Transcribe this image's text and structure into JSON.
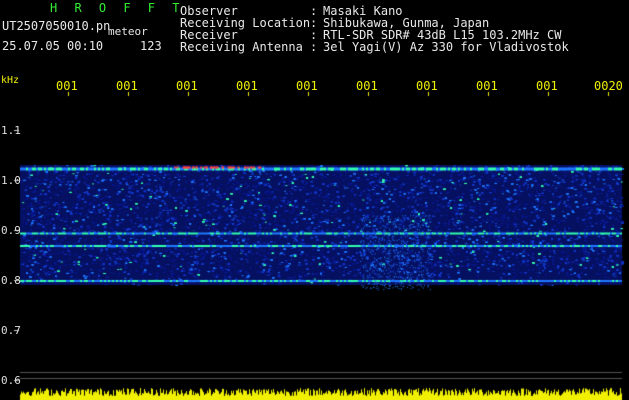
{
  "header": {
    "brand": "H R O F F T",
    "file_name": "UT2507050010.pn",
    "detection_type": "meteor",
    "datetime": "25.07.05 00:10",
    "count": "123"
  },
  "station_info": [
    {
      "label": "Observer",
      "sep": ":",
      "value": "Masaki Kano"
    },
    {
      "label": "Receiving Location",
      "sep": ":",
      "value": "Shibukawa, Gunma, Japan"
    },
    {
      "label": "Receiver",
      "sep": ":",
      "value": "RTL-SDR SDR# 43dB L15 103.2MHz CW"
    },
    {
      "label": "Receiving Antenna",
      "sep": ":",
      "value": "3el Yagi(V) Az 330 for Vladivostok"
    }
  ],
  "axes": {
    "y_unit": "kHz",
    "y_ticks": [
      "1.1",
      "1.0",
      "0.9",
      "0.8",
      "0.7",
      "0.6"
    ],
    "x_ticks": [
      "001",
      "001",
      "001",
      "001",
      "001",
      "001",
      "001",
      "001",
      "001",
      "0020"
    ]
  },
  "spectrogram": {
    "freq_range_khz": [
      0.6,
      1.03
    ],
    "active_band_khz": [
      0.79,
      1.03
    ],
    "bright_lines_khz": [
      1.025,
      0.895,
      0.87,
      0.8
    ],
    "colors": {
      "background": "#000000",
      "low": "#0a1a8c",
      "mid": "#1e78ff",
      "high": "#30ffb0",
      "peak": "#ff4040",
      "text": "#e8e8e8",
      "axis": "#f0f000",
      "baseline": "#f0f000"
    }
  }
}
